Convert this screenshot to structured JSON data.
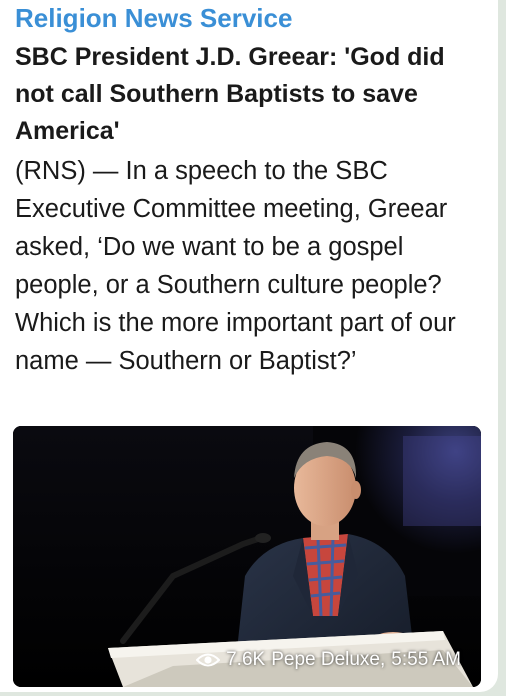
{
  "link_preview": {
    "site_name": "Religion News Service",
    "title": "SBC President J.D. Greear: 'God did not call Southern Baptists to save America'",
    "description": "(RNS) — In a speech to the SBC Executive Committee meeting, Greear asked, ‘Do we want to be a gospel people, or a Southern culture people? Which is the more important part of our name — Southern or Baptist?’"
  },
  "message_meta": {
    "view_icon": "eye-icon",
    "views": "7.6K",
    "author": "Pepe Deluxe,",
    "time": "5:55 AM"
  },
  "colors": {
    "site_name": "#3a8fd6",
    "text": "#1a1a1a",
    "bubble": "#ffffff"
  }
}
